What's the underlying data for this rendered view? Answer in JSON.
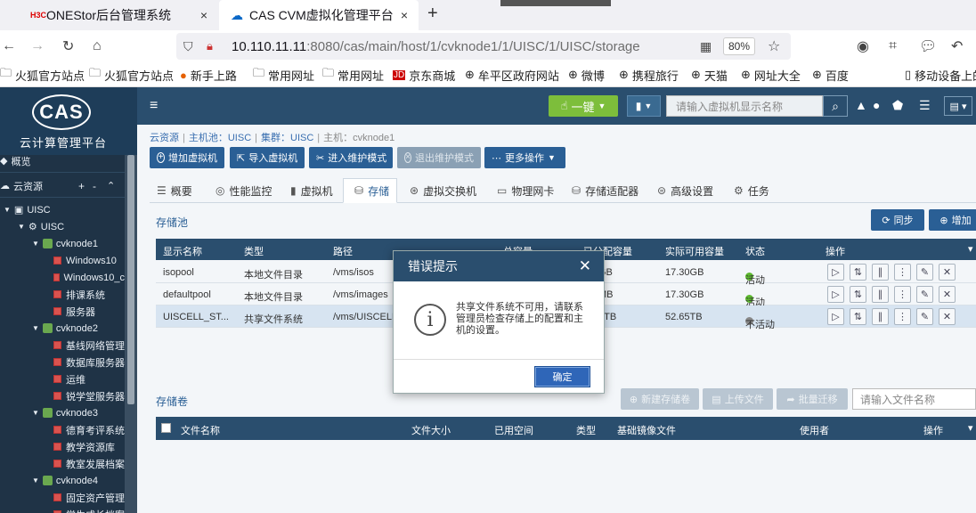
{
  "browser": {
    "tabs": [
      {
        "favicon": "H3C",
        "title": "ONEStor后台管理系统",
        "close": "×"
      },
      {
        "title": "CAS CVM虚拟化管理平台",
        "close": "×"
      }
    ],
    "new_tab": "+",
    "url_host": "10.110.11.11",
    "url_path": ":8080/cas/main/host/1/cvknode1/1/UISC/1/UISC/storage",
    "zoom": "80%",
    "bookmarks": [
      "火狐官方站点",
      "火狐官方站点",
      "新手上路",
      "常用网址",
      "常用网址",
      "京东商城",
      "牟平区政府网站",
      "微博",
      "携程旅行",
      "天猫",
      "网址大全",
      "百度",
      "移动设备上的"
    ]
  },
  "sidebar": {
    "logo": "CAS",
    "logo_sub": "云计算管理平台",
    "overview": "概览",
    "cloud_resources": "云资源",
    "tree": [
      {
        "label": "UISC",
        "level": 0,
        "type": "pool"
      },
      {
        "label": "UISC",
        "level": 1,
        "type": "cluster"
      },
      {
        "label": "cvknode1",
        "level": 2,
        "type": "host"
      },
      {
        "label": "Windows10",
        "level": 3,
        "type": "vm"
      },
      {
        "label": "Windows10_c",
        "level": 3,
        "type": "vm"
      },
      {
        "label": "排课系统",
        "level": 3,
        "type": "vm"
      },
      {
        "label": "服务器",
        "level": 3,
        "type": "vm"
      },
      {
        "label": "cvknode2",
        "level": 2,
        "type": "host"
      },
      {
        "label": "基线网络管理",
        "level": 3,
        "type": "vm"
      },
      {
        "label": "数据库服务器",
        "level": 3,
        "type": "vm"
      },
      {
        "label": "运维",
        "level": 3,
        "type": "vm"
      },
      {
        "label": "锐学堂服务器",
        "level": 3,
        "type": "vm"
      },
      {
        "label": "cvknode3",
        "level": 2,
        "type": "host"
      },
      {
        "label": "德育考评系统",
        "level": 3,
        "type": "vm"
      },
      {
        "label": "教学资源库",
        "level": 3,
        "type": "vm"
      },
      {
        "label": "教室发展档案",
        "level": 3,
        "type": "vm"
      },
      {
        "label": "cvknode4",
        "level": 2,
        "type": "host"
      },
      {
        "label": "固定资产管理",
        "level": 3,
        "type": "vm"
      },
      {
        "label": "学生成长档案",
        "level": 3,
        "type": "vm"
      }
    ]
  },
  "topbar": {
    "one_key": "一键",
    "search_placeholder": "请输入虚拟机显示名称"
  },
  "breadcrumb": [
    "云资源",
    "主机池：UISC",
    "集群：UISC",
    "主机：cvknode1"
  ],
  "actions": [
    "增加虚拟机",
    "导入虚拟机",
    "进入维护模式",
    "退出维护模式",
    "更多操作"
  ],
  "tabs": [
    "概要",
    "性能监控",
    "虚拟机",
    "存储",
    "虚拟交换机",
    "物理网卡",
    "存储适配器",
    "高级设置",
    "任务"
  ],
  "pool_section": {
    "title": "存储池",
    "sync": "同步",
    "add": "增加",
    "headers": [
      "显示名称",
      "类型",
      "路径",
      "总容量",
      "已分配容量",
      "实际可用容量",
      "状态",
      "操作"
    ],
    "rows": [
      {
        "name": "isopool",
        "type": "本地文件目录",
        "path": "/vms/isos",
        "allocated": "GB",
        "available": "17.30GB",
        "status": "活动",
        "status_color": "#5cb82e"
      },
      {
        "name": "defaultpool",
        "type": "本地文件目录",
        "path": "/vms/images",
        "allocated": "MB",
        "available": "17.30GB",
        "status": "活动",
        "status_color": "#5cb82e"
      },
      {
        "name": "UISCELL_ST...",
        "type": "共享文件系统",
        "path": "/vms/UISCELL",
        "allocated": "1TB",
        "available": "52.65TB",
        "status": "不活动",
        "status_color": "#888888"
      }
    ]
  },
  "volume_section": {
    "title": "存储卷",
    "new_volume": "新建存储卷",
    "upload": "上传文件",
    "batch_migrate": "批量迁移",
    "search_placeholder": "请输入文件名称",
    "headers": [
      "文件名称",
      "文件大小",
      "已用空间",
      "类型",
      "基础镜像文件",
      "使用者",
      "操作"
    ]
  },
  "dialog": {
    "title": "错误提示",
    "icon": "i",
    "message": "共享文件系统不可用，请联系管理员检查存储上的配置和主机的设置。",
    "ok": "确定"
  }
}
